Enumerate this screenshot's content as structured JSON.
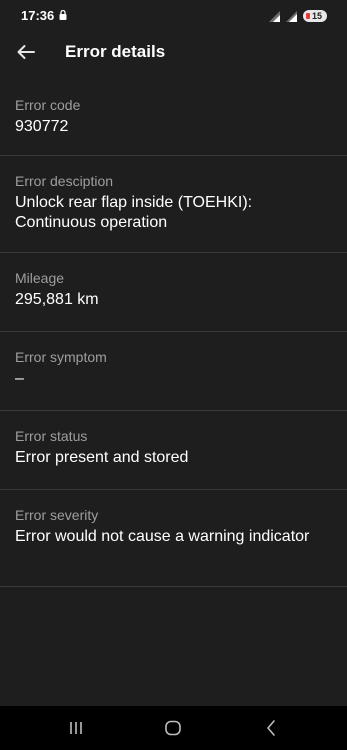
{
  "status_bar": {
    "time": "17:36",
    "battery_level": "15",
    "icons": [
      "lock-icon",
      "signal-icon",
      "signal-icon",
      "battery-icon"
    ]
  },
  "header": {
    "title": "Error details",
    "back_icon": "arrow-left-icon"
  },
  "details": [
    {
      "label": "Error code",
      "value": "930772"
    },
    {
      "label": "Error desciption",
      "value": "Unlock rear flap inside (TOEHKI): Continuous operation"
    },
    {
      "label": "Mileage",
      "value": "295,881 km"
    },
    {
      "label": "Error symptom",
      "value": "–"
    },
    {
      "label": "Error status",
      "value": "Error present and stored"
    },
    {
      "label": "Error severity",
      "value": "Error would not cause a warning indicator"
    }
  ],
  "nav_bar": {
    "icons": [
      "recent-apps-icon",
      "home-icon",
      "back-icon"
    ]
  },
  "colors": {
    "background": "#1e1e1e",
    "label": "#9e9e9e",
    "value": "#ffffff",
    "divider": "#3a3a3a",
    "battery_warning": "#e53935"
  }
}
